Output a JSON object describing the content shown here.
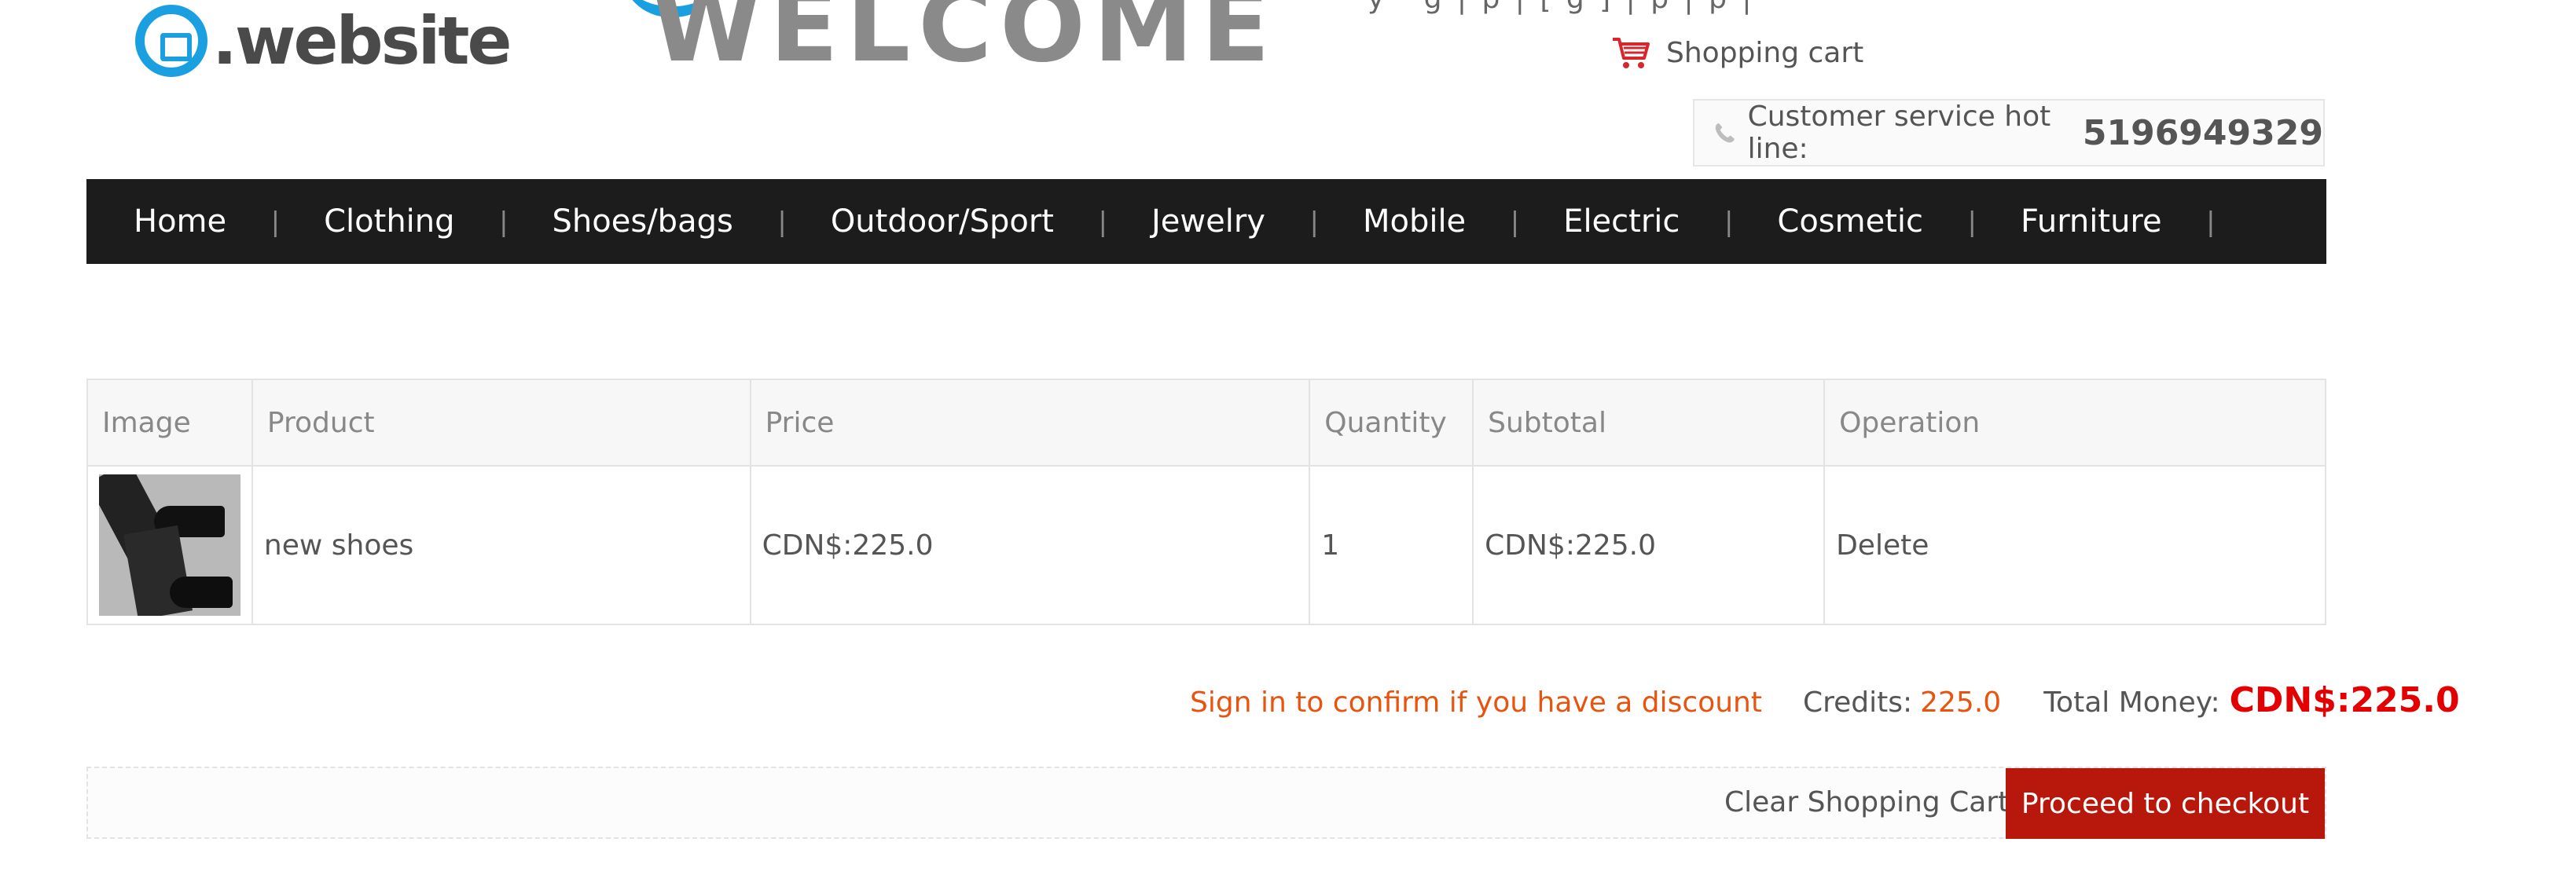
{
  "brand": {
    "logo_text": ".website",
    "welcome_text": "WELCOME"
  },
  "header": {
    "top_links_fragment": "y  ·  g    |    p   |  [  g   ]    |    p           |    p      |",
    "cart_label": "Shopping cart",
    "hotline_label": "Customer service hot line:",
    "hotline_number": "5196949329"
  },
  "nav": {
    "items": [
      "Home",
      "Clothing",
      "Shoes/bags",
      "Outdoor/Sport",
      "Jewelry",
      "Mobile",
      "Electric",
      "Cosmetic",
      "Furniture"
    ]
  },
  "cart_table": {
    "headers": [
      "Image",
      "Product",
      "Price",
      "Quantity",
      "Subtotal",
      "Operation"
    ],
    "rows": [
      {
        "image_alt": "black ankle boots",
        "product": "new shoes",
        "price": "CDN$:225.0",
        "quantity": "1",
        "subtotal": "CDN$:225.0",
        "operation": "Delete"
      }
    ]
  },
  "summary": {
    "discount_prompt": "Sign in to confirm if you have a discount",
    "credits_label": "Credits:",
    "credits_value": "225.0",
    "total_label": "Total Money:",
    "total_value": "CDN$:225.0"
  },
  "actions": {
    "clear_label": "Clear Shopping Cart",
    "checkout_label": "Proceed to checkout"
  },
  "colors": {
    "nav_bg": "#1c1c1c",
    "accent_orange": "#e8540f",
    "total_red": "#e40000",
    "checkout_bg": "#b8180c",
    "logo_blue": "#1a9fe0"
  },
  "icons": [
    "cart-icon",
    "phone-icon"
  ]
}
